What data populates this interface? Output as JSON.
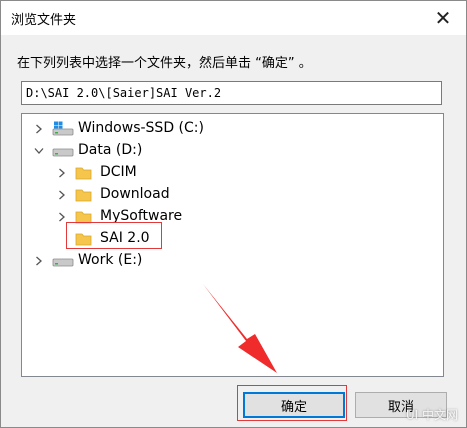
{
  "window": {
    "title": "浏览文件夹",
    "close_glyph": "✕"
  },
  "instruction": "在下列列表中选择一个文件夹，然后单击 “确定” 。",
  "path_field": {
    "value": "D:\\SAI 2.0\\[Saier]SAI Ver.2"
  },
  "tree": {
    "items": [
      {
        "label": "Windows-SSD (C:)",
        "icon": "drive-windows-icon",
        "expanded": false,
        "selected": false
      },
      {
        "label": "Data (D:)",
        "icon": "drive-icon",
        "expanded": true,
        "selected": false
      },
      {
        "label": "DCIM",
        "icon": "folder-icon",
        "expanded": false,
        "selected": false
      },
      {
        "label": "Download",
        "icon": "folder-icon",
        "expanded": false,
        "selected": false
      },
      {
        "label": "MySoftware",
        "icon": "folder-icon",
        "expanded": false,
        "selected": false
      },
      {
        "label": "SAI 2.0",
        "icon": "folder-icon",
        "expanded": false,
        "selected": true
      },
      {
        "label": "Work (E:)",
        "icon": "drive-icon",
        "expanded": false,
        "selected": false
      }
    ]
  },
  "buttons": {
    "ok": "确定",
    "cancel": "取消"
  },
  "colors": {
    "highlight_red": "#e23a3a",
    "folder_yellow": "#f5c64b",
    "focus_blue": "#0078d7"
  },
  "watermark": "UI 中文网"
}
